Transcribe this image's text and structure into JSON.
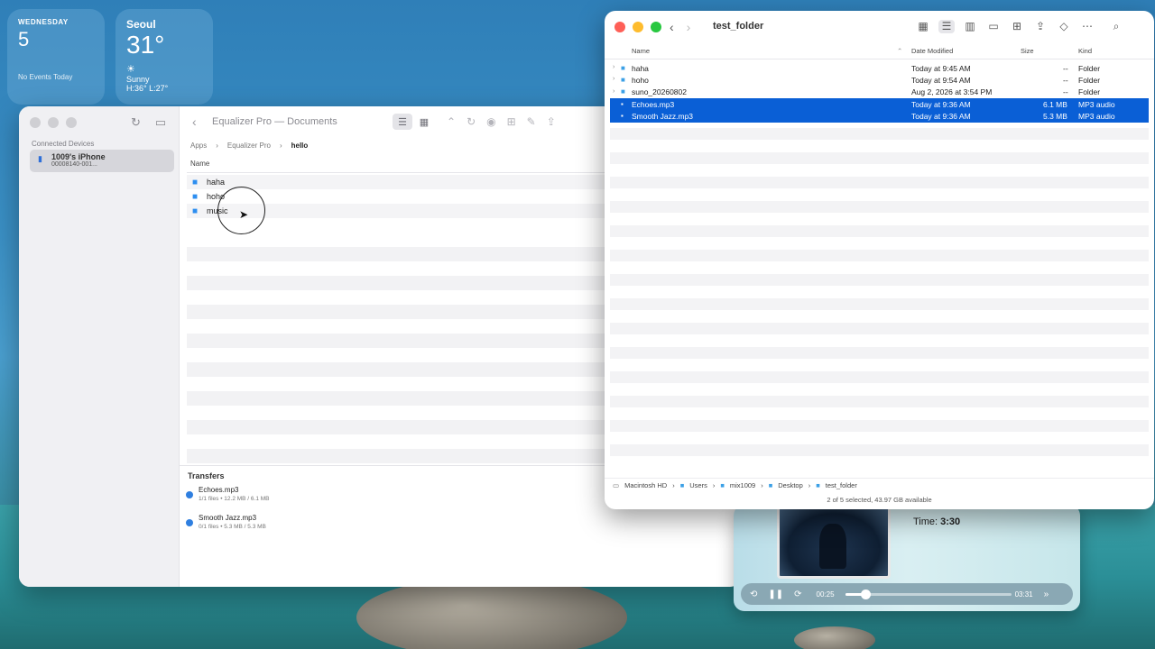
{
  "desktop": {
    "calendar_widget": {
      "weekday": "WEDNESDAY",
      "day": "5",
      "events": "No Events Today"
    },
    "weather_widget": {
      "city": "Seoul",
      "temp": "31°",
      "icon": "sun-icon",
      "condition": "Sunny",
      "hilo": "H:36° L:27°"
    }
  },
  "equalizer": {
    "title": "Equalizer Pro — Documents",
    "sidebar": {
      "section": "Connected Devices",
      "device_name": "1009's iPhone",
      "device_id": "00008140-001..."
    },
    "breadcrumb": [
      "Apps",
      "Equalizer Pro",
      "hello"
    ],
    "column_name": "Name",
    "files": [
      {
        "name": "haha",
        "icon": "folder-icon"
      },
      {
        "name": "hoho",
        "icon": "folder-icon"
      },
      {
        "name": "music",
        "icon": "folder-icon"
      }
    ],
    "transfers": {
      "heading": "Transfers",
      "items": [
        {
          "name": "Echoes.mp3",
          "meta": "1/1 files • 12.2 MB / 6.1 MB"
        },
        {
          "name": "Smooth Jazz.mp3",
          "meta": "0/1 files • 5.3 MB / 5.3 MB"
        }
      ]
    }
  },
  "player": {
    "time_label": "Time:",
    "time_value": "3:30",
    "elapsed": "00:25",
    "duration": "03:31",
    "progress": 0.12
  },
  "finder": {
    "title": "test_folder",
    "columns": {
      "name": "Name",
      "date": "Date Modified",
      "size": "Size",
      "kind": "Kind"
    },
    "rows": [
      {
        "name": "haha",
        "date": "Today at 9:45 AM",
        "size": "--",
        "kind": "Folder",
        "selected": false,
        "folder": true
      },
      {
        "name": "hoho",
        "date": "Today at 9:54 AM",
        "size": "--",
        "kind": "Folder",
        "selected": false,
        "folder": true
      },
      {
        "name": "suno_20260802",
        "date": "Aug 2, 2026 at 3:54 PM",
        "size": "--",
        "kind": "Folder",
        "selected": false,
        "folder": true
      },
      {
        "name": "Echoes.mp3",
        "date": "Today at 9:36 AM",
        "size": "6.1 MB",
        "kind": "MP3 audio",
        "selected": true,
        "folder": false
      },
      {
        "name": "Smooth Jazz.mp3",
        "date": "Today at 9:36 AM",
        "size": "5.3 MB",
        "kind": "MP3 audio",
        "selected": true,
        "folder": false
      }
    ],
    "path": [
      "Macintosh HD",
      "Users",
      "mix1009",
      "Desktop",
      "test_folder"
    ],
    "status": "2 of 5 selected, 43.97 GB available"
  },
  "colors": {
    "selection": "#0a5fd6",
    "folder": "#3ca0e6",
    "accent_blue": "#2f7fe0"
  }
}
